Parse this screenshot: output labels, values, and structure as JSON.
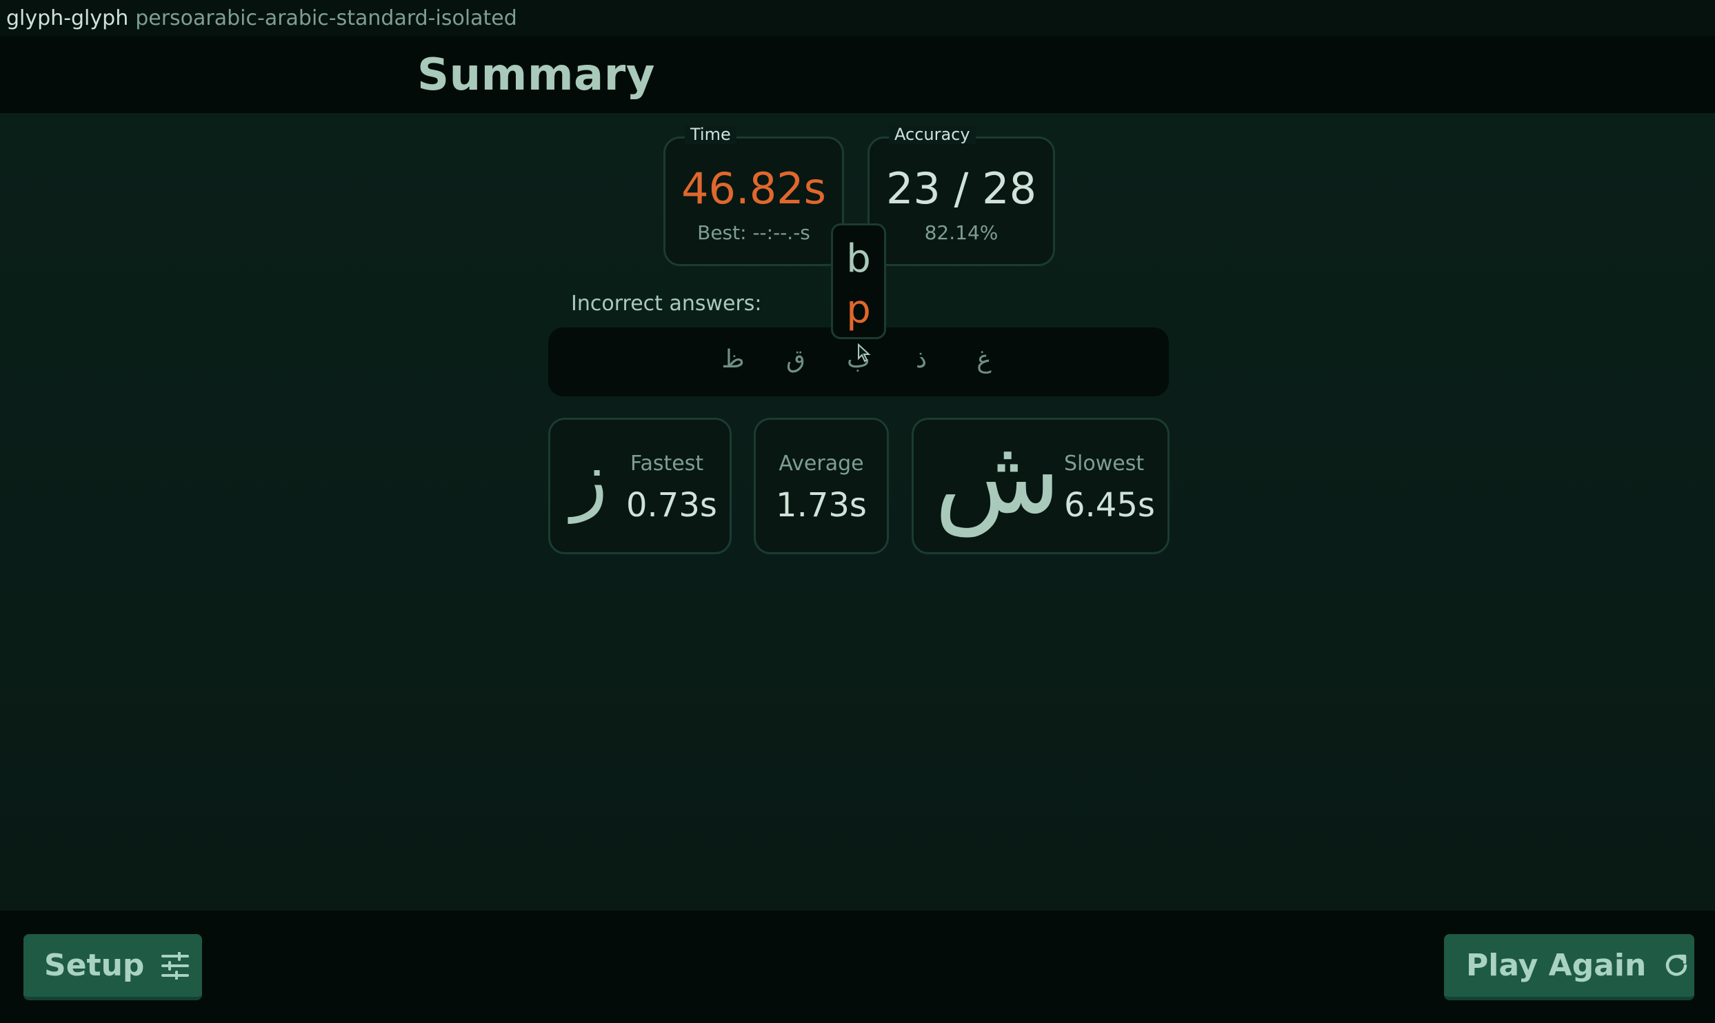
{
  "titlebar": {
    "app_name": "glyph-glyph",
    "subtitle": "persoarabic-arabic-standard-isolated"
  },
  "header": {
    "title": "Summary"
  },
  "time_box": {
    "legend": "Time",
    "value": "46.82s",
    "best": "Best: --:--.-s",
    "value_color": "#e0672d"
  },
  "accuracy_box": {
    "legend": "Accuracy",
    "value": "23 / 28",
    "percent": "82.14%"
  },
  "incorrect": {
    "label": "Incorrect answers:",
    "glyphs": [
      "ظ",
      "ق",
      "ب",
      "ذ",
      "غ"
    ]
  },
  "tooltip": {
    "correct": "b",
    "given": "p",
    "given_color": "#e0672d"
  },
  "fastest": {
    "glyph": "ز",
    "label": "Fastest",
    "value": "0.73s"
  },
  "average": {
    "label": "Average",
    "value": "1.73s"
  },
  "slowest": {
    "glyph": "ش",
    "label": "Slowest",
    "value": "6.45s"
  },
  "footer": {
    "setup_label": "Setup",
    "setup_icon": "sliders-icon",
    "play_again_label": "Play Again",
    "play_again_icon": "refresh-icon"
  }
}
